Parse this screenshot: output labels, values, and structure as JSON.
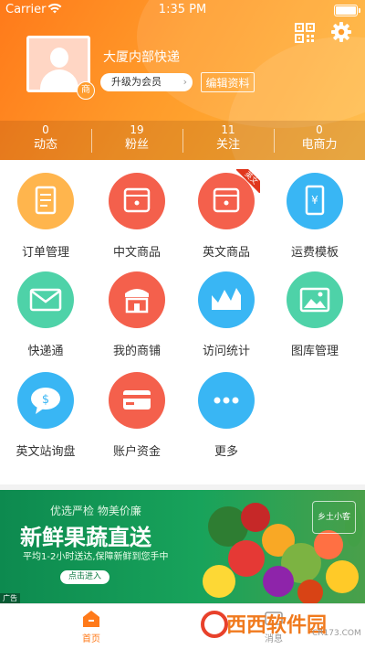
{
  "status_bar": {
    "carrier": "Carrier",
    "time": "1:35 PM"
  },
  "profile": {
    "badge": "商",
    "company": "大厦内部快递",
    "upgrade_label": "升级为会员",
    "upgrade_chevron": "›",
    "edit_label": "编辑资料"
  },
  "stats": [
    {
      "value": "0",
      "label": "动态"
    },
    {
      "value": "19",
      "label": "粉丝"
    },
    {
      "value": "11",
      "label": "关注"
    },
    {
      "value": "0",
      "label": "电商力"
    }
  ],
  "menu": [
    {
      "label": "订单管理",
      "color": "#ffb54d",
      "icon": "order-icon"
    },
    {
      "label": "中文商品",
      "color": "#f4604c",
      "icon": "product-icon"
    },
    {
      "label": "英文商品",
      "color": "#f4604c",
      "icon": "product-icon",
      "ribbon": "英文"
    },
    {
      "label": "运费模板",
      "color": "#39b6f4",
      "icon": "freight-icon"
    },
    {
      "label": "快递通",
      "color": "#4ed2a8",
      "icon": "mail-icon"
    },
    {
      "label": "我的商铺",
      "color": "#f4604c",
      "icon": "shop-icon"
    },
    {
      "label": "访问统计",
      "color": "#39b6f4",
      "icon": "stats-icon"
    },
    {
      "label": "图库管理",
      "color": "#4ed2a8",
      "icon": "gallery-icon"
    },
    {
      "label": "英文站询盘",
      "color": "#39b6f4",
      "icon": "chat-icon"
    },
    {
      "label": "账户资金",
      "color": "#f4604c",
      "icon": "card-icon"
    },
    {
      "label": "更多",
      "color": "#39b6f4",
      "icon": "more-icon"
    }
  ],
  "banner": {
    "tag": "优选严检  物美价廉",
    "headline": "新鲜果蔬直送",
    "sub": "平均1-2小时送达,保障新鲜到您手中",
    "enter": "点击进入",
    "ad": "广告",
    "brand": "乡土小客"
  },
  "tabbar": [
    {
      "label": "首页",
      "active": true
    },
    {
      "label": "消息",
      "active": false
    }
  ],
  "watermark": {
    "text": "西西软件园",
    "url": "CR173.COM"
  },
  "colors": {
    "accent": "#ff7a1a",
    "tab_active": "#ff7a1a"
  }
}
